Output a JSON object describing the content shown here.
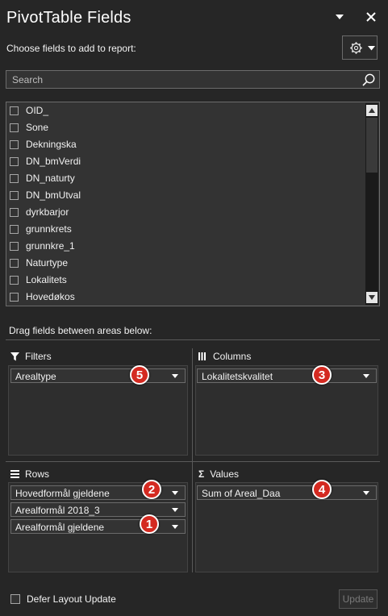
{
  "header": {
    "title": "PivotTable Fields"
  },
  "choose_label": "Choose fields to add to report:",
  "search": {
    "placeholder": "Search"
  },
  "fields": [
    {
      "label": "OID_",
      "checked": false
    },
    {
      "label": "Sone",
      "checked": false
    },
    {
      "label": "Dekningska",
      "checked": false
    },
    {
      "label": "DN_bmVerdi",
      "checked": false
    },
    {
      "label": "DN_naturty",
      "checked": false
    },
    {
      "label": "DN_bmUtval",
      "checked": false
    },
    {
      "label": "dyrkbarjor",
      "checked": false
    },
    {
      "label": "grunnkrets",
      "checked": false
    },
    {
      "label": "grunnkre_1",
      "checked": false
    },
    {
      "label": "Naturtype",
      "checked": false
    },
    {
      "label": "Lokalitets",
      "checked": false
    },
    {
      "label": "Hovedøkos",
      "checked": false
    }
  ],
  "drag_label": "Drag fields between areas below:",
  "areas": {
    "filters": {
      "title": "Filters",
      "items": [
        {
          "label": "Arealtype",
          "badge": "5"
        }
      ]
    },
    "columns": {
      "title": "Columns",
      "items": [
        {
          "label": "Lokalitetskvalitet",
          "badge": "3"
        }
      ]
    },
    "rows": {
      "title": "Rows",
      "items": [
        {
          "label": "Hovedformål gjeldene",
          "badge": "2"
        },
        {
          "label": "Arealformål 2018_3",
          "badge": ""
        },
        {
          "label": "Arealformål gjeldene",
          "badge": "1"
        }
      ]
    },
    "values": {
      "title": "Values",
      "items": [
        {
          "label": "Sum of Areal_Daa",
          "badge": "4"
        }
      ]
    }
  },
  "footer": {
    "defer_label": "Defer Layout Update",
    "update_label": "Update"
  },
  "colors": {
    "background": "#262626",
    "badge": "#d42a21",
    "border": "#6b6b6b"
  }
}
